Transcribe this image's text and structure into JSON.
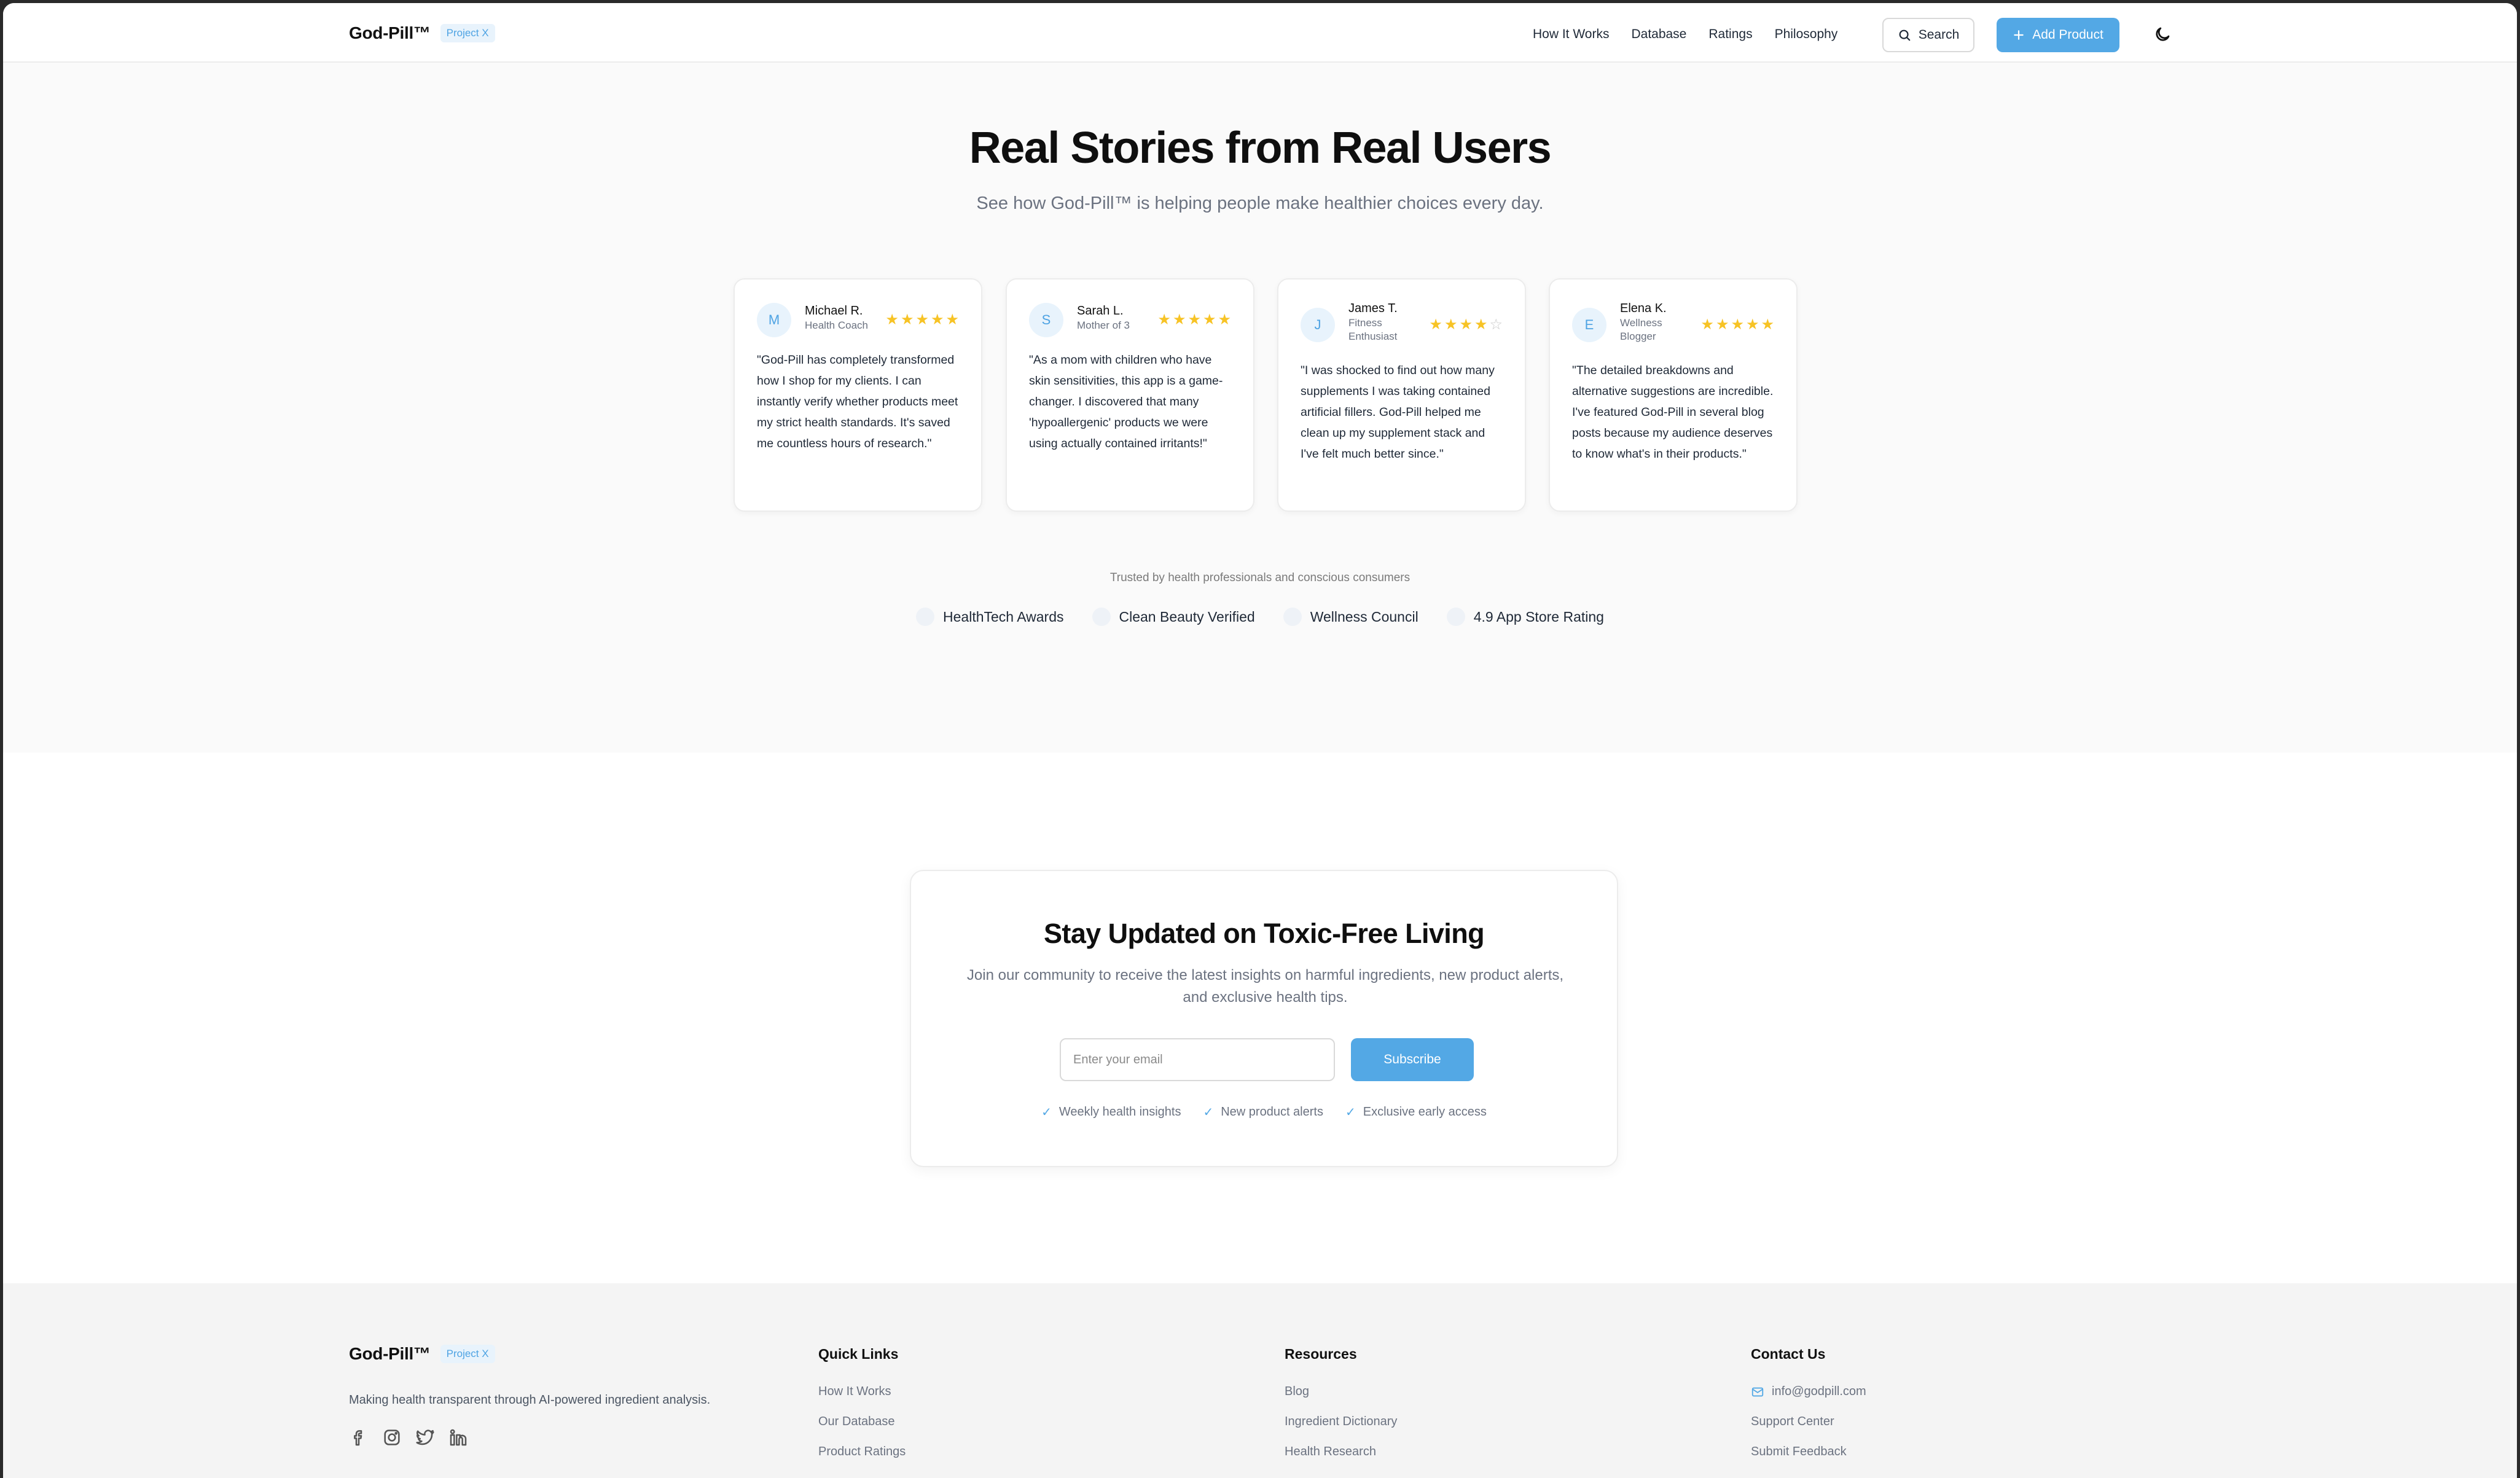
{
  "nav": {
    "brand": "God-Pill™",
    "badge": "Project X",
    "links": [
      "How It Works",
      "Database",
      "Ratings",
      "Philosophy"
    ],
    "search_label": "Search",
    "add_label": "Add Product",
    "theme_icon": "moon-icon"
  },
  "testimonials": {
    "title": "Real Stories from Real Users",
    "subtitle": "See how God-Pill™ is helping people make healthier choices every day.",
    "cards": [
      {
        "initial": "M",
        "name": "Michael R.",
        "role": "Health Coach",
        "rating": 5,
        "quote": "\"God-Pill has completely transformed how I shop for my clients. I can instantly verify whether products meet my strict health standards. It's saved me countless hours of research.\""
      },
      {
        "initial": "S",
        "name": "Sarah L.",
        "role": "Mother of 3",
        "rating": 5,
        "quote": "\"As a mom with children who have skin sensitivities, this app is a game-changer. I discovered that many 'hypoallergenic' products we were using actually contained irritants!\""
      },
      {
        "initial": "J",
        "name": "James T.",
        "role": "Fitness Enthusiast",
        "rating": 4,
        "quote": "\"I was shocked to find out how many supplements I was taking contained artificial fillers. God-Pill helped me clean up my supplement stack and I've felt much better since.\""
      },
      {
        "initial": "E",
        "name": "Elena K.",
        "role": "Wellness Blogger",
        "rating": 5,
        "quote": "\"The detailed breakdowns and alternative suggestions are incredible. I've featured God-Pill in several blog posts because my audience deserves to know what's in their products.\""
      }
    ],
    "trusted_label": "Trusted by health professionals and conscious consumers",
    "trust_items": [
      "HealthTech Awards",
      "Clean Beauty Verified",
      "Wellness Council",
      "4.9 App Store Rating"
    ]
  },
  "newsletter": {
    "title": "Stay Updated on Toxic-Free Living",
    "subtitle": "Join our community to receive the latest insights on harmful ingredients, new product alerts, and exclusive health tips.",
    "input_placeholder": "Enter your email",
    "button_label": "Subscribe",
    "perks": [
      "Weekly health insights",
      "New product alerts",
      "Exclusive early access"
    ]
  },
  "footer": {
    "brand": "God-Pill™",
    "badge": "Project X",
    "tagline": "Making health transparent through AI-powered ingredient analysis.",
    "socials": [
      "facebook-icon",
      "instagram-icon",
      "twitter-icon",
      "linkedin-icon"
    ],
    "columns": [
      {
        "title": "Quick Links",
        "links": [
          "How It Works",
          "Our Database",
          "Product Ratings"
        ]
      },
      {
        "title": "Resources",
        "links": [
          "Blog",
          "Ingredient Dictionary",
          "Health Research"
        ]
      },
      {
        "title": "Contact Us",
        "links": [
          "info@godpill.com",
          "Support Center",
          "Submit Feedback"
        ]
      }
    ]
  },
  "colors": {
    "accent": "#53a8e5",
    "star": "#f7c325",
    "badge_bg": "#e8f3fc",
    "section_bg": "#fafafa",
    "footer_bg": "#f4f4f4"
  }
}
